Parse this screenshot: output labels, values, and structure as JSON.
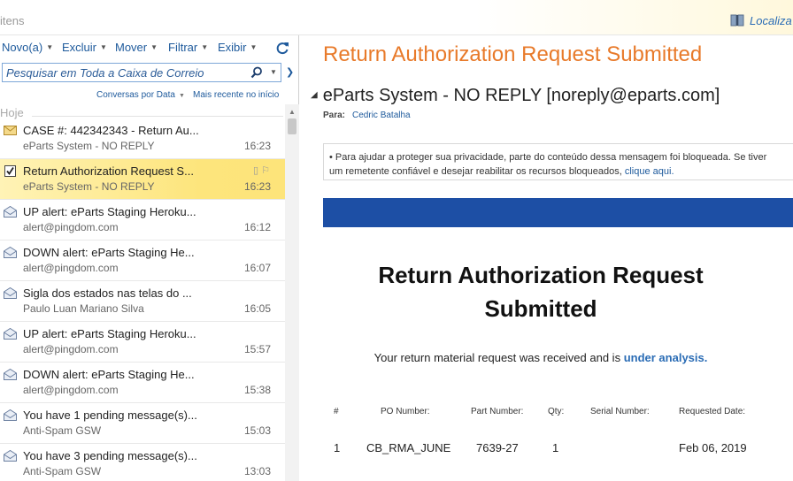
{
  "topbar": {
    "crumb": "itens",
    "find_label": "Localiza",
    "find_icon": "book-icon"
  },
  "toolbar": {
    "new_label": "Novo(a)",
    "delete_label": "Excluir",
    "move_label": "Mover",
    "filter_label": "Filtrar",
    "view_label": "Exibir",
    "refresh_icon": "refresh-icon"
  },
  "search": {
    "placeholder": "Pesquisar em Toda a Caixa de Correio"
  },
  "sort": {
    "arrange_label": "Conversas por Data",
    "order_label": "Mais recente no início"
  },
  "group": {
    "today_label": "Hoje"
  },
  "messages": [
    {
      "subject": "CASE #: 442342343 - Return Au...",
      "sender": "eParts System - NO REPLY",
      "time": "16:23",
      "icon": "envelope-icon",
      "selected": false
    },
    {
      "subject": "Return Authorization Request S...",
      "sender": "eParts System - NO REPLY",
      "time": "16:23",
      "icon": "checkbox-icon",
      "selected": true
    },
    {
      "subject": "UP alert: eParts Staging Heroku...",
      "sender": "alert@pingdom.com",
      "time": "16:12",
      "icon": "open-envelope-icon",
      "selected": false
    },
    {
      "subject": "DOWN alert: eParts Staging He...",
      "sender": "alert@pingdom.com",
      "time": "16:07",
      "icon": "open-envelope-icon",
      "selected": false
    },
    {
      "subject": "Sigla dos estados nas telas do ...",
      "sender": "Paulo Luan Mariano Silva",
      "time": "16:05",
      "icon": "open-envelope-icon",
      "selected": false
    },
    {
      "subject": "UP alert: eParts Staging Heroku...",
      "sender": "alert@pingdom.com",
      "time": "15:57",
      "icon": "open-envelope-icon",
      "selected": false
    },
    {
      "subject": "DOWN alert: eParts Staging He...",
      "sender": "alert@pingdom.com",
      "time": "15:38",
      "icon": "open-envelope-icon",
      "selected": false
    },
    {
      "subject": "You have 1 pending message(s)...",
      "sender": "Anti-Spam GSW",
      "time": "15:03",
      "icon": "open-envelope-icon",
      "selected": false
    },
    {
      "subject": "You have 3 pending message(s)...",
      "sender": "Anti-Spam GSW",
      "time": "13:03",
      "icon": "open-envelope-icon",
      "selected": false
    }
  ],
  "reading": {
    "title": "Return Authorization Request Submitted",
    "from": "eParts System - NO REPLY [noreply@eparts.com]",
    "to_label": "Para:",
    "to_name": "Cedric Batalha",
    "info_line1": "• Para ajudar a proteger sua privacidade, parte do conteúdo dessa mensagem foi bloqueada. Se tiver",
    "info_line2_prefix": "um remetente confiável e desejar reabilitar os recursos bloqueados,",
    "info_link": "clique aqui.",
    "banner_color": "#1d4fa5",
    "email_title_line1": "Return Authorization Request",
    "email_title_line2": "Submitted",
    "email_msg_prefix": "Your return material request was received and is",
    "email_msg_highlight": "under analysis.",
    "table": {
      "headers": [
        "#",
        "PO Number:",
        "Part Number:",
        "Qty:",
        "Serial Number:",
        "Requested Date:"
      ],
      "rows": [
        [
          "1",
          "CB_RMA_JUNE",
          "7639-27",
          "1",
          "",
          "Feb 06, 2019"
        ]
      ]
    }
  },
  "colors": {
    "accent_orange": "#e87a2a",
    "link_blue": "#1e5a9c",
    "selection_yellow": "#fde57c"
  }
}
